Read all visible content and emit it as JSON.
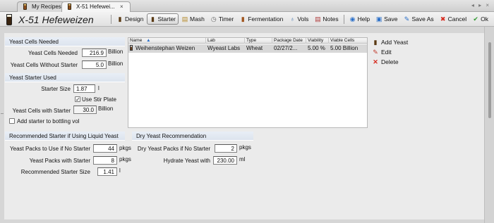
{
  "tabs": [
    {
      "label": "My Recipes",
      "closable": false
    },
    {
      "label": "X-51 Hefewei...",
      "closable": true
    }
  ],
  "nav_arrows": "◂ ▸ ×",
  "recipe_title": "X-51 Hefeweizen",
  "toolbar": {
    "design": "Design",
    "starter": "Starter",
    "mash": "Mash",
    "timer": "Timer",
    "fermentation": "Fermentation",
    "vols": "Vols",
    "notes": "Notes",
    "help": "Help",
    "save": "Save",
    "save_as": "Save As",
    "cancel": "Cancel",
    "ok": "Ok"
  },
  "yeast_cells_needed": {
    "heading": "Yeast Cells Needed",
    "needed_label": "Yeast Cells Needed",
    "needed_value": "216.9",
    "needed_unit": "Billion",
    "without_label": "Yeast Cells Without Starter",
    "without_value": "5.0",
    "without_unit": "Billion"
  },
  "starter_used": {
    "heading": "Yeast Starter Used",
    "size_label": "Starter Size",
    "size_value": "1.87",
    "size_unit": "l",
    "stir_label": "Use Stir Plate",
    "stir_checked": true,
    "with_label": "Yeast Cells with Starter",
    "with_value": "30.0",
    "with_unit": "Billion",
    "bottling_label": "Add starter to bottling vol",
    "bottling_checked": false
  },
  "liquid": {
    "heading": "Recommended Starter if Using Liquid Yeast",
    "packs_no_label": "Yeast Packs to Use if No Starter",
    "packs_no_value": "44",
    "packs_no_unit": "pkgs",
    "packs_with_label": "Yeast Packs with Starter",
    "packs_with_value": "8",
    "packs_with_unit": "pkgs",
    "rec_size_label": "Recommended Starter Size",
    "rec_size_value": "1.41",
    "rec_size_unit": "l"
  },
  "dry": {
    "heading": "Dry Yeast Recommendation",
    "packs_label": "Dry Yeast Packs if No Starter",
    "packs_value": "2",
    "packs_unit": "pkgs",
    "hydrate_label": "Hydrate Yeast with",
    "hydrate_value": "230.00",
    "hydrate_unit": "ml"
  },
  "yeast_table": {
    "columns": [
      "Name",
      "Lab",
      "Type",
      "Package Date",
      "Viability",
      "Viable Cells"
    ],
    "sorted_column": "Name",
    "rows": [
      [
        "Weihenstephan Weizen",
        "Wyeast Labs",
        "Wheat",
        "02/27/2...",
        "5.00 %",
        "5.00 Billion"
      ]
    ]
  },
  "side_actions": {
    "add": "Add Yeast",
    "edit": "Edit",
    "delete": "Delete"
  },
  "colors": {
    "accent_blue": "#2a6fc9",
    "delete_red": "#d62a1e",
    "ok_green": "#2f9a2f",
    "section_header_bg": "#e3e9f2",
    "selected_row": "#d8d8d8"
  }
}
